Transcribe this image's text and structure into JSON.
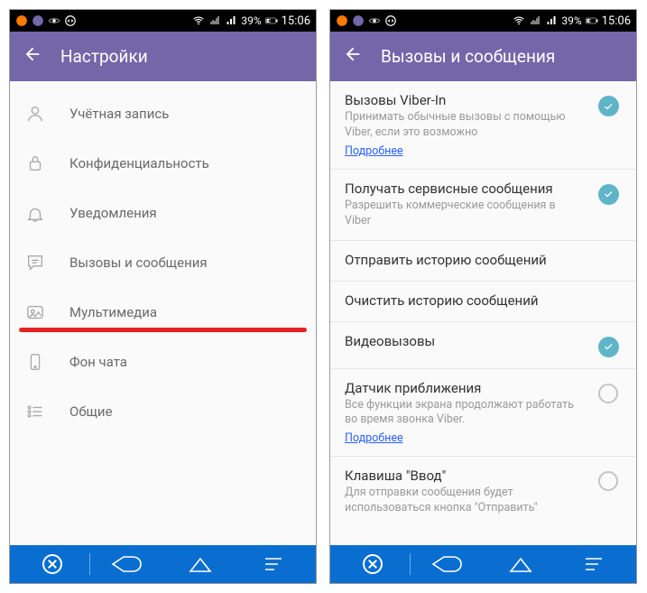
{
  "status": {
    "battery_pct": "39%",
    "time": "15:06"
  },
  "left": {
    "title": "Настройки",
    "items": [
      {
        "label": "Учётная запись"
      },
      {
        "label": "Конфиденциальность"
      },
      {
        "label": "Уведомления"
      },
      {
        "label": "Вызовы и сообщения"
      },
      {
        "label": "Мультимедиа"
      },
      {
        "label": "Фон чата"
      },
      {
        "label": "Общие"
      }
    ]
  },
  "right": {
    "title": "Вызовы и сообщения",
    "options": {
      "viber_in": {
        "title": "Вызовы Viber-In",
        "sub": "Принимать обычные вызовы с помощью Viber, если это возможно",
        "link": "Подробнее"
      },
      "service_msgs": {
        "title": "Получать сервисные сообщения",
        "sub": "Разрешить коммерческие сообщения в Viber"
      },
      "send_history": {
        "title": "Отправить историю сообщений"
      },
      "clear_history": {
        "title": "Очистить историю сообщений"
      },
      "video_calls": {
        "title": "Видеовызовы"
      },
      "proximity": {
        "title": "Датчик приближения",
        "sub": "Все функции экрана продолжают работать во время звонка Viber.",
        "link": "Подробнее"
      },
      "enter_key": {
        "title": "Клавиша \"Ввод\"",
        "sub": "Для отправки сообщения будет использоваться кнопка \"Отправить\""
      }
    }
  }
}
